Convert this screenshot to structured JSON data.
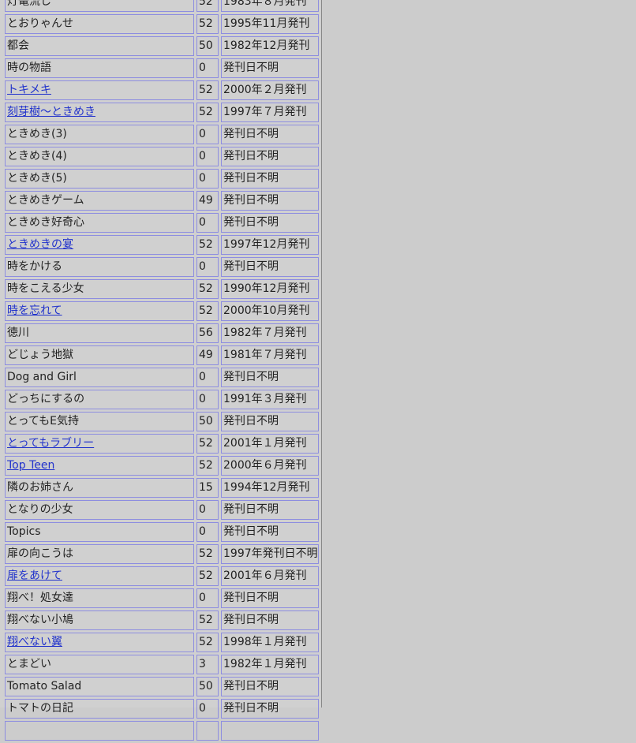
{
  "rows": [
    {
      "title": "灯篭流し",
      "linked": false,
      "count": "52",
      "date": "1983年８月発刊"
    },
    {
      "title": "とおりゃんせ",
      "linked": false,
      "count": "52",
      "date": "1995年11月発刊"
    },
    {
      "title": "都会",
      "linked": false,
      "count": "50",
      "date": "1982年12月発刊"
    },
    {
      "title": "時の物語",
      "linked": false,
      "count": "0",
      "date": "発刊日不明"
    },
    {
      "title": "トキメキ",
      "linked": true,
      "count": "52",
      "date": "2000年２月発刊"
    },
    {
      "title": "刻芽樹〜ときめき",
      "linked": true,
      "count": "52",
      "date": "1997年７月発刊"
    },
    {
      "title": "ときめき(3)",
      "linked": false,
      "count": "0",
      "date": "発刊日不明"
    },
    {
      "title": "ときめき(4)",
      "linked": false,
      "count": "0",
      "date": "発刊日不明"
    },
    {
      "title": "ときめき(5)",
      "linked": false,
      "count": "0",
      "date": "発刊日不明"
    },
    {
      "title": "ときめきゲーム",
      "linked": false,
      "count": "49",
      "date": "発刊日不明"
    },
    {
      "title": "ときめき好奇心",
      "linked": false,
      "count": "0",
      "date": "発刊日不明"
    },
    {
      "title": "ときめきの宴",
      "linked": true,
      "count": "52",
      "date": "1997年12月発刊"
    },
    {
      "title": "時をかける",
      "linked": false,
      "count": "0",
      "date": "発刊日不明"
    },
    {
      "title": "時をこえる少女",
      "linked": false,
      "count": "52",
      "date": "1990年12月発刊"
    },
    {
      "title": "時を忘れて",
      "linked": true,
      "count": "52",
      "date": "2000年10月発刊"
    },
    {
      "title": "徳川",
      "linked": false,
      "count": "56",
      "date": "1982年７月発刊"
    },
    {
      "title": "どじょう地獄",
      "linked": false,
      "count": "49",
      "date": "1981年７月発刊"
    },
    {
      "title": "Dog and Girl",
      "linked": false,
      "count": "0",
      "date": "発刊日不明"
    },
    {
      "title": "どっちにするの",
      "linked": false,
      "count": "0",
      "date": "1991年３月発刊"
    },
    {
      "title": "とってもE気持",
      "linked": false,
      "count": "50",
      "date": "発刊日不明"
    },
    {
      "title": "とってもラブリー",
      "linked": true,
      "count": "52",
      "date": "2001年１月発刊"
    },
    {
      "title": "Top Teen",
      "linked": true,
      "count": "52",
      "date": "2000年６月発刊"
    },
    {
      "title": "隣のお姉さん",
      "linked": false,
      "count": "15",
      "date": "1994年12月発刊"
    },
    {
      "title": "となりの少女",
      "linked": false,
      "count": "0",
      "date": "発刊日不明"
    },
    {
      "title": "Topics",
      "linked": false,
      "count": "0",
      "date": "発刊日不明"
    },
    {
      "title": "扉の向こうは",
      "linked": false,
      "count": "52",
      "date": "1997年発刊日不明"
    },
    {
      "title": "扉をあけて",
      "linked": true,
      "count": "52",
      "date": "2001年６月発刊"
    },
    {
      "title": "翔べ！処女達",
      "linked": false,
      "count": "0",
      "date": "発刊日不明"
    },
    {
      "title": "翔べない小鳩",
      "linked": false,
      "count": "52",
      "date": "発刊日不明"
    },
    {
      "title": "翔べない翼",
      "linked": true,
      "count": "52",
      "date": "1998年１月発刊"
    },
    {
      "title": "とまどい",
      "linked": false,
      "count": "3",
      "date": "1982年１月発刊"
    },
    {
      "title": "Tomato Salad",
      "linked": false,
      "count": "50",
      "date": "発刊日不明"
    },
    {
      "title": "トマトの日記",
      "linked": false,
      "count": "0",
      "date": "発刊日不明"
    },
    {
      "title": "",
      "linked": false,
      "count": "",
      "date": ""
    }
  ],
  "colors": {
    "background": "#cccccc",
    "cell_border": "#8d8de0",
    "link": "#2233cc"
  }
}
